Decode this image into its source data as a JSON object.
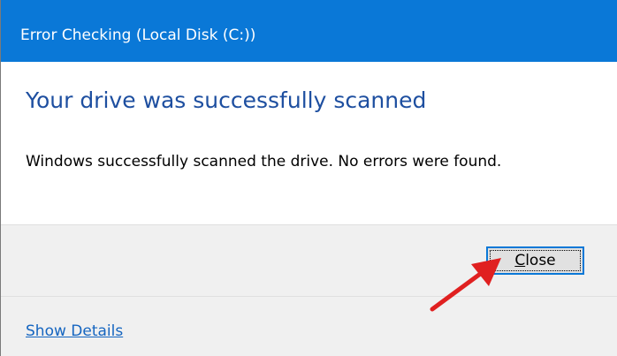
{
  "window": {
    "title": "Error Checking (Local Disk (C:))"
  },
  "content": {
    "heading": "Your drive was successfully scanned",
    "message": "Windows successfully scanned the drive. No errors were found."
  },
  "buttons": {
    "close_accel": "C",
    "close_rest": "lose"
  },
  "footer": {
    "show_details_label": "Show Details"
  },
  "colors": {
    "title_bar": "#0a78d7",
    "heading_text": "#1e4fa0",
    "link": "#1565c0",
    "annotation_arrow": "#e02020"
  },
  "icons": {
    "annotation": "red-arrow-icon"
  }
}
